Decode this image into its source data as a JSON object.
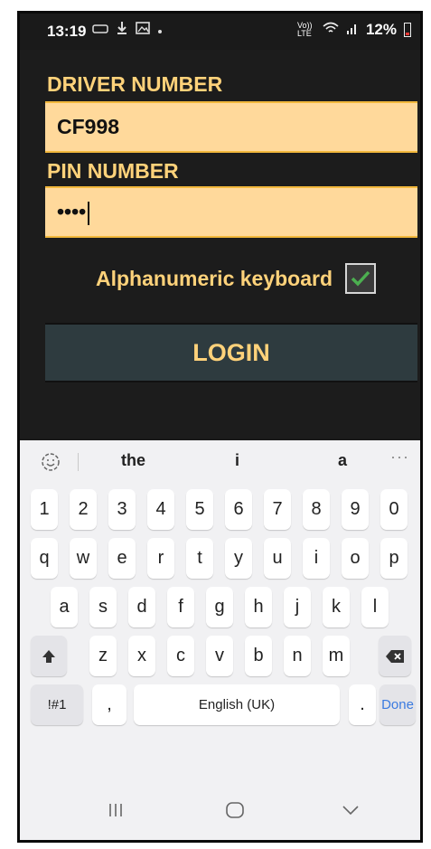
{
  "status_bar": {
    "time": "13:19",
    "network": "Vo)) LTE",
    "battery": "12%"
  },
  "form": {
    "driver_label": "DRIVER NUMBER",
    "driver_value": "CF998",
    "pin_label": "PIN NUMBER",
    "pin_value": "••••",
    "alpha_label": "Alphanumeric keyboard",
    "alpha_checked": true,
    "login_label": "LOGIN"
  },
  "keyboard": {
    "suggestions": [
      "the",
      "i",
      "a"
    ],
    "more": "···",
    "row_numbers": [
      "1",
      "2",
      "3",
      "4",
      "5",
      "6",
      "7",
      "8",
      "9",
      "0"
    ],
    "row_q": [
      "q",
      "w",
      "e",
      "r",
      "t",
      "y",
      "u",
      "i",
      "o",
      "p"
    ],
    "row_a": [
      "a",
      "s",
      "d",
      "f",
      "g",
      "h",
      "j",
      "k",
      "l"
    ],
    "row_z": [
      "z",
      "x",
      "c",
      "v",
      "b",
      "n",
      "m"
    ],
    "symbols": "!#1",
    "comma": ",",
    "space": "English (UK)",
    "period": ".",
    "done": "Done"
  },
  "colors": {
    "label": "#ffd27a",
    "field_bg": "#ffd99b",
    "field_border": "#f2b83c",
    "login_bg": "#2e3b3f",
    "check": "#4caf50",
    "done": "#3b7be0"
  },
  "icons": {
    "status_left": [
      "cast-icon",
      "download-icon",
      "gallery-icon"
    ],
    "status_right": [
      "wifi-icon",
      "signal-icon",
      "battery-icon"
    ],
    "keyboard": [
      "emoji-settings-icon",
      "shift-icon",
      "backspace-icon"
    ],
    "nav": [
      "recents-icon",
      "home-icon",
      "back-icon"
    ]
  }
}
